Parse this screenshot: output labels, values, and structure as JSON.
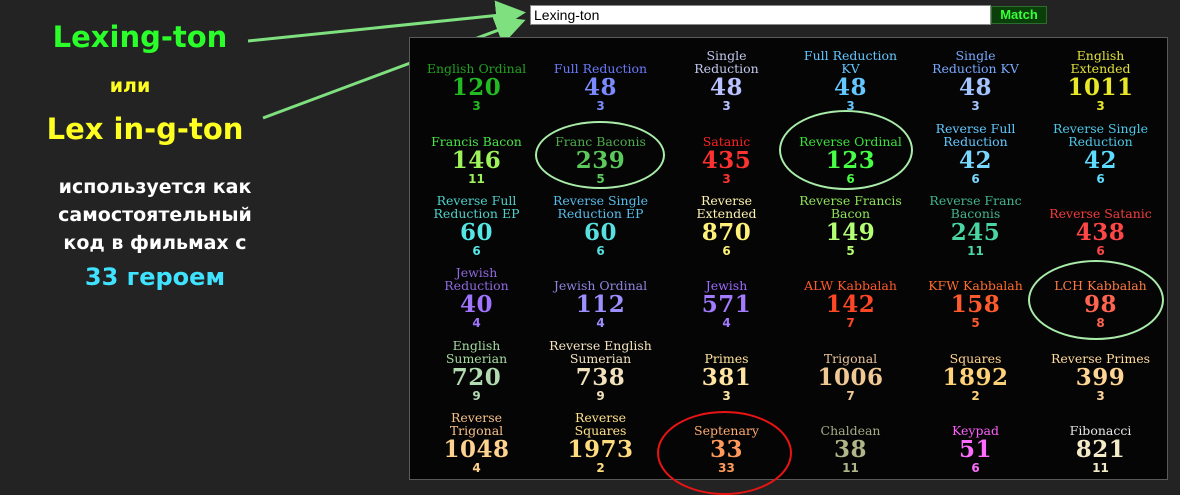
{
  "search": {
    "value": "Lexing-ton"
  },
  "match_button": {
    "label": "Match"
  },
  "annotation": {
    "line1": "Lexing-ton",
    "line2": "или",
    "line3": "Lex in-g-ton",
    "line4": "используется как",
    "line5": "самостоятельный",
    "line6": "код в фильмах с",
    "line7": "33 героем"
  },
  "ciphers": [
    {
      "name": "English Ordinal",
      "value": "120",
      "reduction": "3",
      "color": "#22a022",
      "vcolor": "#22bb22",
      "rcolor": "#22bb22"
    },
    {
      "name": "Full Reduction",
      "value": "48",
      "reduction": "3",
      "color": "#6a7bff",
      "vcolor": "#7b8bff",
      "rcolor": "#7b8bff"
    },
    {
      "name": "Single\nReduction",
      "value": "48",
      "reduction": "3",
      "color": "#c3c9ee",
      "vcolor": "#b9c2ff",
      "rcolor": "#b9c2ff"
    },
    {
      "name": "Full Reduction\nKV",
      "value": "48",
      "reduction": "3",
      "color": "#64c7ff",
      "vcolor": "#64c7ff",
      "rcolor": "#64c7ff"
    },
    {
      "name": "Single\nReduction KV",
      "value": "48",
      "reduction": "3",
      "color": "#78a9ff",
      "vcolor": "#a3c4ff",
      "rcolor": "#a3c4ff"
    },
    {
      "name": "English\nExtended",
      "value": "1011",
      "reduction": "3",
      "color": "#e1e13c",
      "vcolor": "#e8e828",
      "rcolor": "#e8e828"
    },
    {
      "name": "Francis Bacon",
      "value": "146",
      "reduction": "11",
      "color": "#47e347",
      "vcolor": "#9ef25a",
      "rcolor": "#9ef25a"
    },
    {
      "name": "Franc Baconis",
      "value": "239",
      "reduction": "5",
      "color": "#4dab4d",
      "vcolor": "#5cc95c",
      "rcolor": "#5cc95c"
    },
    {
      "name": "Satanic",
      "value": "435",
      "reduction": "3",
      "color": "#ff2222",
      "vcolor": "#ff3232",
      "rcolor": "#ff3232"
    },
    {
      "name": "Reverse Ordinal",
      "value": "123",
      "reduction": "6",
      "color": "#3be13b",
      "vcolor": "#46ff46",
      "rcolor": "#46ff46"
    },
    {
      "name": "Reverse Full\nReduction",
      "value": "42",
      "reduction": "6",
      "color": "#63c8ff",
      "vcolor": "#7ad7ff",
      "rcolor": "#7ad7ff"
    },
    {
      "name": "Reverse Single\nReduction",
      "value": "42",
      "reduction": "6",
      "color": "#4ec8e8",
      "vcolor": "#5edcff",
      "rcolor": "#5edcff"
    },
    {
      "name": "Reverse Full\nReduction EP",
      "value": "60",
      "reduction": "6",
      "color": "#4ed1c9",
      "vcolor": "#55e6e6",
      "rcolor": "#55e6e6"
    },
    {
      "name": "Reverse Single\nReduction EP",
      "value": "60",
      "reduction": "6",
      "color": "#58bcea",
      "vcolor": "#58dfe0",
      "rcolor": "#58dfe0"
    },
    {
      "name": "Reverse\nExtended",
      "value": "870",
      "reduction": "6",
      "color": "#fff3b0",
      "vcolor": "#fff27a",
      "rcolor": "#fff27a"
    },
    {
      "name": "Reverse Francis\nBacon",
      "value": "149",
      "reduction": "5",
      "color": "#8ee35a",
      "vcolor": "#b4ff74",
      "rcolor": "#b4ff74"
    },
    {
      "name": "Reverse Franc\nBaconis",
      "value": "245",
      "reduction": "11",
      "color": "#43b58c",
      "vcolor": "#49d6a2",
      "rcolor": "#49d6a2"
    },
    {
      "name": "Reverse Satanic",
      "value": "438",
      "reduction": "6",
      "color": "#f63c3c",
      "vcolor": "#ff4646",
      "rcolor": "#ff4646"
    },
    {
      "name": "Jewish\nReduction",
      "value": "40",
      "reduction": "4",
      "color": "#8f6ae0",
      "vcolor": "#9f74ff",
      "rcolor": "#9f74ff"
    },
    {
      "name": "Jewish Ordinal",
      "value": "112",
      "reduction": "4",
      "color": "#8e84e0",
      "vcolor": "#9d8fff",
      "rcolor": "#9d8fff"
    },
    {
      "name": "Jewish",
      "value": "571",
      "reduction": "4",
      "color": "#9d6bff",
      "vcolor": "#a27bff",
      "rcolor": "#a27bff"
    },
    {
      "name": "ALW Kabbalah",
      "value": "142",
      "reduction": "7",
      "color": "#ff5a2a",
      "vcolor": "#ff4726",
      "rcolor": "#ff4726"
    },
    {
      "name": "KFW Kabbalah",
      "value": "158",
      "reduction": "5",
      "color": "#ff6c2c",
      "vcolor": "#ff5a2d",
      "rcolor": "#ff5a2d"
    },
    {
      "name": "LCH Kabbalah",
      "value": "98",
      "reduction": "8",
      "color": "#ff7a45",
      "vcolor": "#ff6450",
      "rcolor": "#ff6450"
    },
    {
      "name": "English\nSumerian",
      "value": "720",
      "reduction": "9",
      "color": "#a5dba0",
      "vcolor": "#b1dab1",
      "rcolor": "#b1dab1"
    },
    {
      "name": "Reverse English\nSumerian",
      "value": "738",
      "reduction": "9",
      "color": "#f3e3bf",
      "vcolor": "#f1e1bd",
      "rcolor": "#f1e1bd"
    },
    {
      "name": "Primes",
      "value": "381",
      "reduction": "3",
      "color": "#ffe49a",
      "vcolor": "#ffe4a4",
      "rcolor": "#ffe4a4"
    },
    {
      "name": "Trigonal",
      "value": "1006",
      "reduction": "7",
      "color": "#e8c39a",
      "vcolor": "#f0c893",
      "rcolor": "#f0c893"
    },
    {
      "name": "Squares",
      "value": "1892",
      "reduction": "2",
      "color": "#ffd38e",
      "vcolor": "#ffd27a",
      "rcolor": "#ffd27a"
    },
    {
      "name": "Reverse Primes",
      "value": "399",
      "reduction": "3",
      "color": "#ffdc9d",
      "vcolor": "#ffd596",
      "rcolor": "#ffd596"
    },
    {
      "name": "Reverse\nTrigonal",
      "value": "1048",
      "reduction": "4",
      "color": "#f5c08a",
      "vcolor": "#ffd28f",
      "rcolor": "#ffd28f"
    },
    {
      "name": "Reverse\nSquares",
      "value": "1973",
      "reduction": "2",
      "color": "#ffe08c",
      "vcolor": "#ffdc7e",
      "rcolor": "#ffdc7e"
    },
    {
      "name": "Septenary",
      "value": "33",
      "reduction": "33",
      "color": "#ffab70",
      "vcolor": "#ff9a5c",
      "rcolor": "#ff9a5c"
    },
    {
      "name": "Chaldean",
      "value": "38",
      "reduction": "11",
      "color": "#a5aa86",
      "vcolor": "#b0b68a",
      "rcolor": "#b0b68a"
    },
    {
      "name": "Keypad",
      "value": "51",
      "reduction": "6",
      "color": "#ff5fff",
      "vcolor": "#ff6cff",
      "rcolor": "#ff6cff"
    },
    {
      "name": "Fibonacci",
      "value": "821",
      "reduction": "11",
      "color": "#e5e5e5",
      "vcolor": "#f3eac8",
      "rcolor": "#f3eac8"
    }
  ],
  "colors": {
    "annotation_green": "#22ff22",
    "annotation_yellow": "#ffff22",
    "annotation_white": "#ffffff",
    "annotation_cyan": "#33ddff",
    "arrow_green": "#7fe07f",
    "highlight_green": "#a9eca9",
    "highlight_red": "#e81313"
  }
}
